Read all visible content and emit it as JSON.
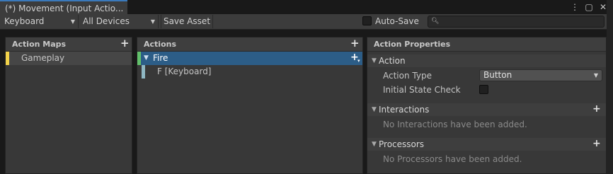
{
  "window": {
    "tab_title": "(*) Movement (Input Actio...",
    "menu_icon": "kebab-menu-icon",
    "maximize_icon": "maximize-icon",
    "close_icon": "close-icon"
  },
  "toolbar": {
    "control_scheme": "Keyboard",
    "device": "All Devices",
    "save_label": "Save Asset",
    "autosave_label": "Auto-Save",
    "autosave_checked": false,
    "search_placeholder": "",
    "search_icon": "search-icon"
  },
  "action_maps": {
    "header": "Action Maps",
    "add_icon": "plus-icon",
    "items": [
      {
        "label": "Gameplay",
        "color": "#f2d24a"
      }
    ]
  },
  "actions": {
    "header": "Actions",
    "add_icon": "plus-icon",
    "items": [
      {
        "label": "Fire",
        "selected": true,
        "color": "#62c06b"
      }
    ],
    "bindings": [
      {
        "label": "F [Keyboard]",
        "color": "#8fb7c3"
      }
    ]
  },
  "properties": {
    "header": "Action Properties",
    "action_section": "Action",
    "action_type_label": "Action Type",
    "action_type_value": "Button",
    "initial_state_label": "Initial State Check",
    "initial_state_checked": false,
    "interactions_section": "Interactions",
    "interactions_empty": "No Interactions have been added.",
    "processors_section": "Processors",
    "processors_empty": "No Processors have been added."
  },
  "colors": {
    "selection": "#2c5d87",
    "tab_accent": "#3a79bb"
  }
}
